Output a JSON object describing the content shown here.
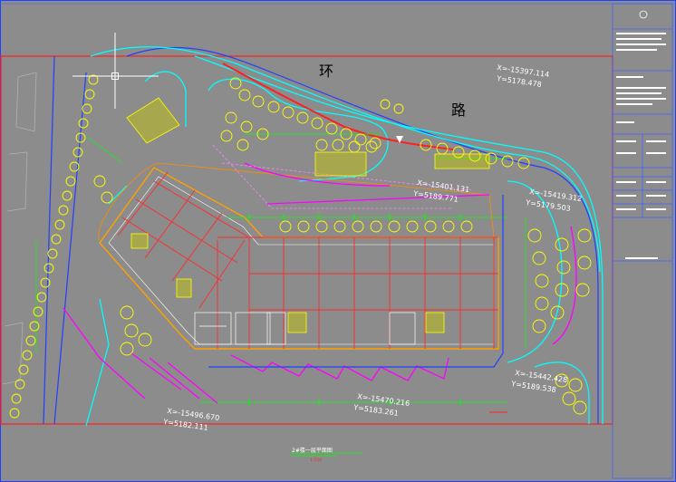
{
  "drawing": {
    "road_label_1": "环",
    "road_label_2": "路",
    "coordinates": [
      {
        "x": "X=-15397.114",
        "y": "Y=5178.478"
      },
      {
        "x": "X=-15401.131",
        "y": "Y=5189.771"
      },
      {
        "x": "X=-15419.312",
        "y": "Y=5179.503"
      },
      {
        "x": "X=-15442.428",
        "y": "Y=5189.538"
      },
      {
        "x": "X=-15470.216",
        "y": "Y=5183.261"
      },
      {
        "x": "X=-15496.670",
        "y": "Y=5182.111"
      }
    ],
    "plan_title": "2#楼一层平面图",
    "plan_scale": "1:150"
  },
  "colors": {
    "background": "#8c8c8c",
    "frame": "#ff2020",
    "grid": "#ff3030",
    "tree": "#ffff00",
    "road": "#00ffff",
    "landscape": "#ff00ff",
    "dimension": "#00ff00",
    "wall": "#ffffff",
    "boundary": "#2040ff"
  },
  "icons": [
    "crosshair-cursor-icon",
    "north-arrow-icon",
    "tree-symbol-icon"
  ]
}
